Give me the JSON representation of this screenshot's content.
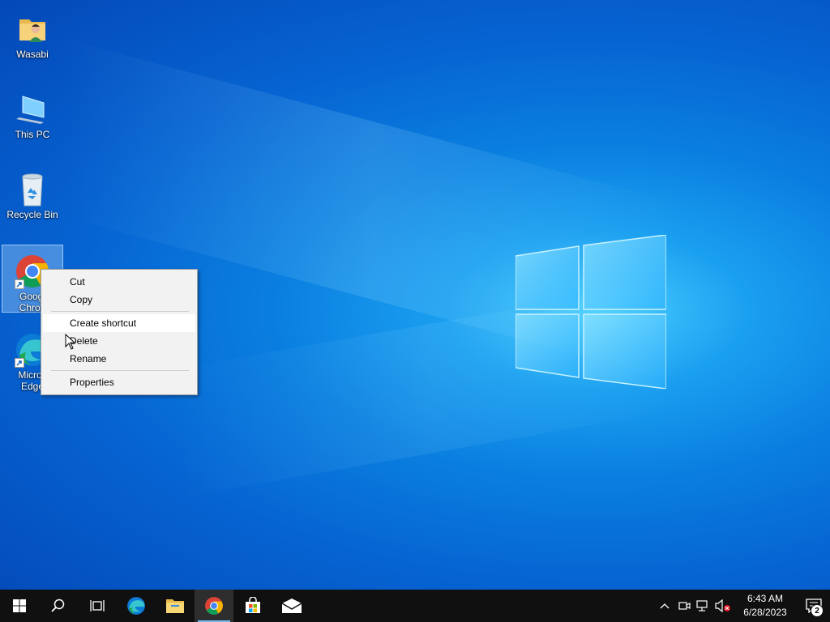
{
  "desktop": {
    "icons": [
      {
        "label": "Wasabi",
        "icon": "user-folder-icon"
      },
      {
        "label": "This PC",
        "icon": "computer-icon"
      },
      {
        "label": "Recycle Bin",
        "icon": "recycle-bin-icon"
      },
      {
        "label": "Googl\nChron",
        "icon": "chrome-icon"
      },
      {
        "label": "Micros\nEdge",
        "icon": "edge-icon"
      }
    ]
  },
  "context_menu": {
    "items": [
      "Cut",
      "Copy",
      "Create shortcut",
      "Delete",
      "Rename",
      "Properties"
    ]
  },
  "taskbar": {
    "apps": [
      "start-icon",
      "search-icon",
      "task-view-icon",
      "edge-icon",
      "file-explorer-icon",
      "chrome-icon",
      "store-icon",
      "mail-icon"
    ],
    "tray": {
      "time": "6:43 AM",
      "date": "6/28/2023",
      "notification_count": "2"
    }
  },
  "colors": {
    "taskbar": "#101010",
    "accent": "#76b9ed",
    "menu_bg": "#f2f2f2"
  }
}
